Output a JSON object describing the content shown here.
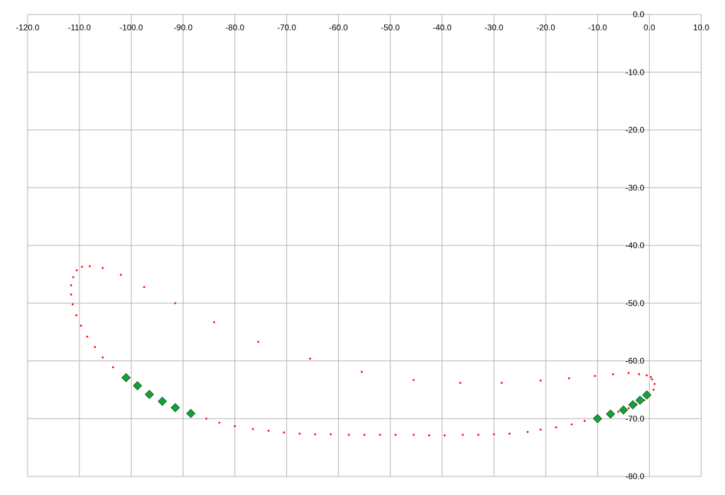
{
  "chart_data": {
    "type": "scatter",
    "title": "",
    "xlabel": "",
    "ylabel": "",
    "xlim": [
      -120,
      10
    ],
    "ylim": [
      -80,
      0
    ],
    "x_ticks": [
      -120,
      -110,
      -100,
      -90,
      -80,
      -70,
      -60,
      -50,
      -40,
      -30,
      -20,
      -10,
      0,
      10
    ],
    "y_ticks": [
      0,
      -10,
      -20,
      -30,
      -40,
      -50,
      -60,
      -70,
      -80
    ],
    "x_tick_labels": [
      "-120.0",
      "-110.0",
      "-100.0",
      "-90.0",
      "-80.0",
      "-70.0",
      "-60.0",
      "-50.0",
      "-40.0",
      "-30.0",
      "-20.0",
      "-10.0",
      "0.0",
      "10.0"
    ],
    "y_tick_labels": [
      "0.0",
      "-10.0",
      "-20.0",
      "-30.0",
      "-40.0",
      "-50.0",
      "-60.0",
      "-70.0",
      "-80.0"
    ],
    "grid": true,
    "legend": "none",
    "series": [
      {
        "color": "#ff0000",
        "marker": "small-diamond",
        "points": [
          [
            0.5,
            -63.2
          ],
          [
            1.0,
            -64.0
          ],
          [
            0.8,
            -65.0
          ],
          [
            0.0,
            -66.0
          ],
          [
            -1.0,
            -66.8
          ],
          [
            -2.5,
            -67.5
          ],
          [
            -4.0,
            -68.2
          ],
          [
            -6.0,
            -68.8
          ],
          [
            -8.0,
            -69.3
          ],
          [
            -10.5,
            -69.8
          ],
          [
            -12.5,
            -70.4
          ],
          [
            -15.0,
            -71.0
          ],
          [
            -18.0,
            -71.5
          ],
          [
            -21.0,
            -71.9
          ],
          [
            -23.5,
            -72.3
          ],
          [
            -27.0,
            -72.6
          ],
          [
            -30.0,
            -72.7
          ],
          [
            -33.0,
            -72.8
          ],
          [
            -36.0,
            -72.8
          ],
          [
            -39.5,
            -72.9
          ],
          [
            -42.5,
            -72.9
          ],
          [
            -45.5,
            -72.8
          ],
          [
            -49.0,
            -72.8
          ],
          [
            -52.0,
            -72.8
          ],
          [
            -55.0,
            -72.8
          ],
          [
            -58.0,
            -72.8
          ],
          [
            -61.5,
            -72.7
          ],
          [
            -64.5,
            -72.7
          ],
          [
            -67.5,
            -72.6
          ],
          [
            -70.5,
            -72.4
          ],
          [
            -73.5,
            -72.1
          ],
          [
            -76.5,
            -71.8
          ],
          [
            -80.0,
            -71.3
          ],
          [
            -83.0,
            -70.7
          ],
          [
            -85.5,
            -70.0
          ],
          [
            -88.5,
            -69.2
          ],
          [
            -91.5,
            -68.2
          ],
          [
            -94.0,
            -67.0
          ],
          [
            -96.5,
            -65.9
          ],
          [
            -99.0,
            -64.4
          ],
          [
            -101.5,
            -62.8
          ],
          [
            -103.5,
            -61.1
          ],
          [
            -105.5,
            -59.4
          ],
          [
            -107.0,
            -57.6
          ],
          [
            -108.5,
            -55.8
          ],
          [
            -109.7,
            -53.9
          ],
          [
            -110.6,
            -52.1
          ],
          [
            -111.3,
            -50.2
          ],
          [
            -111.6,
            -48.5
          ],
          [
            -111.6,
            -46.9
          ],
          [
            -111.2,
            -45.5
          ],
          [
            -110.5,
            -44.3
          ],
          [
            -109.5,
            -43.7
          ],
          [
            -108.0,
            -43.6
          ],
          [
            -105.5,
            -43.9
          ],
          [
            -102.0,
            -45.1
          ],
          [
            -97.5,
            -47.2
          ],
          [
            -91.5,
            -50.0
          ],
          [
            -84.0,
            -53.3
          ],
          [
            -75.5,
            -56.7
          ],
          [
            -65.5,
            -59.6
          ],
          [
            -55.5,
            -61.9
          ],
          [
            -45.5,
            -63.3
          ],
          [
            -36.5,
            -63.8
          ],
          [
            -28.5,
            -63.8
          ],
          [
            -21.0,
            -63.4
          ],
          [
            -15.5,
            -63.0
          ],
          [
            -10.5,
            -62.6
          ],
          [
            -7.0,
            -62.3
          ],
          [
            -4.0,
            -62.1
          ],
          [
            -2.0,
            -62.3
          ],
          [
            -0.5,
            -62.5
          ],
          [
            0.3,
            -62.8
          ]
        ]
      },
      {
        "color": "#1a9e3a",
        "marker": "large-diamond",
        "points": [
          [
            -101.0,
            -62.9
          ],
          [
            -98.8,
            -64.3
          ],
          [
            -96.5,
            -65.8
          ],
          [
            -94.0,
            -67.0
          ],
          [
            -91.5,
            -68.1
          ],
          [
            -88.5,
            -69.1
          ],
          [
            -0.5,
            -65.9
          ],
          [
            -1.8,
            -66.8
          ],
          [
            -3.2,
            -67.6
          ],
          [
            -5.0,
            -68.5
          ],
          [
            -7.5,
            -69.2
          ],
          [
            -10.0,
            -70.0
          ]
        ]
      }
    ]
  }
}
